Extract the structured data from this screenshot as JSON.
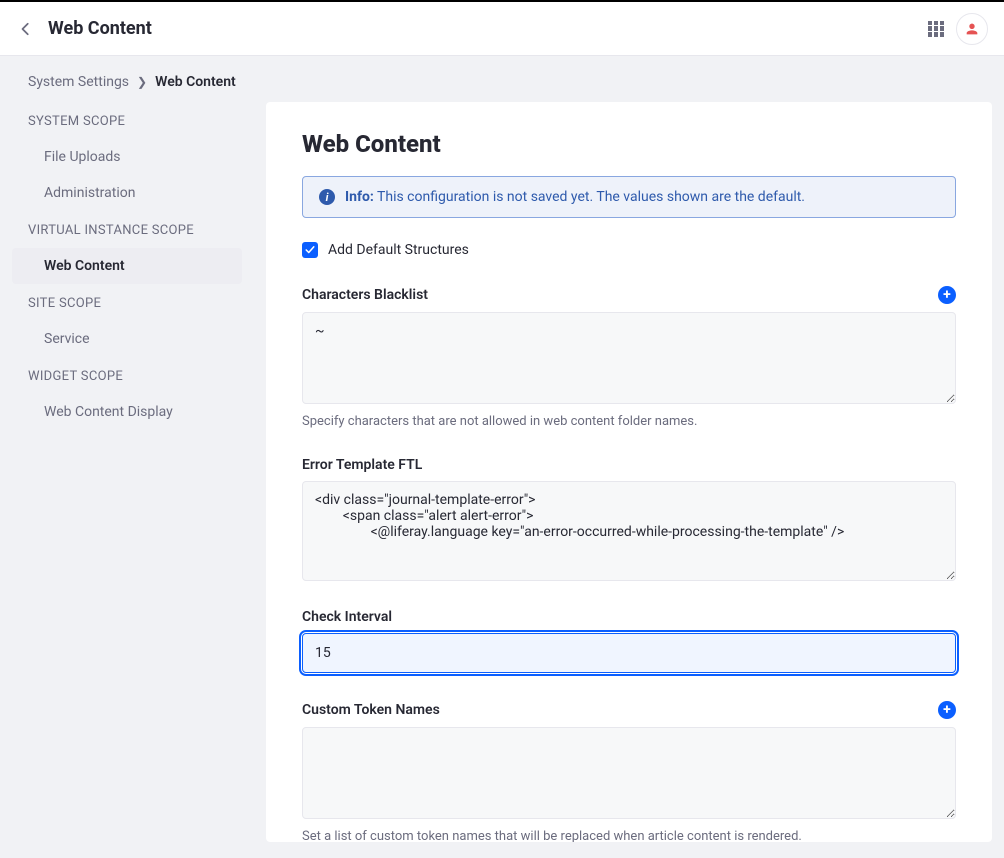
{
  "topbar": {
    "title": "Web Content"
  },
  "breadcrumb": {
    "link": "System Settings",
    "current": "Web Content"
  },
  "sidebar": {
    "scopes": [
      {
        "header": "SYSTEM SCOPE",
        "items": [
          {
            "label": "File Uploads",
            "active": false
          },
          {
            "label": "Administration",
            "active": false
          }
        ]
      },
      {
        "header": "VIRTUAL INSTANCE SCOPE",
        "items": [
          {
            "label": "Web Content",
            "active": true
          }
        ]
      },
      {
        "header": "SITE SCOPE",
        "items": [
          {
            "label": "Service",
            "active": false
          }
        ]
      },
      {
        "header": "WIDGET SCOPE",
        "items": [
          {
            "label": "Web Content Display",
            "active": false
          }
        ]
      }
    ]
  },
  "main": {
    "title": "Web Content",
    "info_label": "Info:",
    "info_text": "This configuration is not saved yet. The values shown are the default.",
    "checkbox_label": "Add Default Structures",
    "blacklist": {
      "label": "Characters Blacklist",
      "value": "~",
      "help": "Specify characters that are not allowed in web content folder names."
    },
    "error_template": {
      "label": "Error Template FTL",
      "value": "<div class=\"journal-template-error\">\n        <span class=\"alert alert-error\">\n                <@liferay.language key=\"an-error-occurred-while-processing-the-template\" />"
    },
    "check_interval": {
      "label": "Check Interval",
      "value": "15"
    },
    "custom_tokens": {
      "label": "Custom Token Names",
      "value": "",
      "help": "Set a list of custom token names that will be replaced when article content is rendered."
    }
  }
}
